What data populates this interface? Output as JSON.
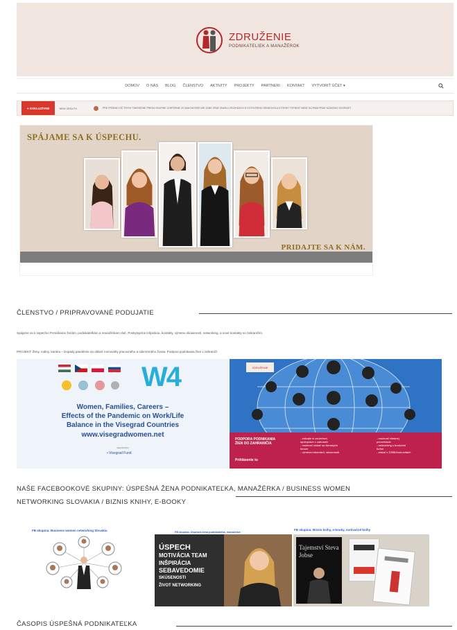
{
  "header": {
    "logo_title": "ZDRUŽENIE",
    "logo_subtitle": "PODNIKATELIEK A MANAŽÉROK"
  },
  "nav": {
    "items": [
      "DOMOV",
      "O NÁS",
      "BLOG",
      "ČLENSTVO",
      "AKTIVITY",
      "PROJEKTY",
      "PARTNERI",
      "KONTAKT",
      "VYTVORIŤ ÚČET ▾"
    ],
    "search_icon": "search-icon"
  },
  "ticker": {
    "badge": "● EXKLUZÍVNE",
    "section": "NEW ZEALTH",
    "text": "PRE PRÍSNEJ OČ TRYNY TAKRIEDNE PREDA SKUPINE ZLEPŠENIE ZO NAKOM RISE ARI ZANE ZENE SNASLU ROZHODOV E KOTOVRENO SENDOVOLA KTORNÝ TOPNINÝ NEDE SLOPAM PRAE NZAVENO SOGRADIT"
  },
  "hero": {
    "title": "SPÁJAME SA K ÚSPECHU.",
    "cta": "PRIDAJTE SA K NÁM."
  },
  "membership": {
    "heading": "ČLENSTVO / PRIPRAVOVANÉ PODUJATIE",
    "text1": "Spájame sa k úspechu! Pomáhame ženám, podnikateľkám a manažérkam rásť. Poskytujeme inšpiráciu, kontakty, výmenu skúseností, networking, a nové kontakty so zahraničím.",
    "text2": "PROJEKT: Ženy, rodiny, kariéra – Dopady pandémie na oblasť rovnováhy pracovného a súkromného života. Podpora podnikania žien v zahraničí"
  },
  "w4_banner": {
    "logo": "W4",
    "title_line1": "Women, Families, Careers –",
    "title_line2": "Effects of the Pandemic on Work/Life",
    "title_line3": "Balance in the Visegrad Countries",
    "website": "www.visegradwomen.net",
    "supported": "supported by",
    "fund": "• Visegrad Fund"
  },
  "globe_banner": {
    "logo": "ZDRUŽENIE",
    "title_line1": "PODPORA PODNIKANIA",
    "title_line2": "ŽIEN DO ZAHRANIČIA",
    "footer": "Prihlásenie tu",
    "list_a": [
      "- získajte si zaobchod-",
      "  spolupráce z zahraničí",
      "- možnosť získať sa členských",
      "  fóroch",
      "- výmena informácií, skúsenosti"
    ],
    "list_b": [
      "- možnosť vlastnej",
      "  prezentácie",
      "- networking s budúcimi",
      "  ľuďmi",
      "- získať v ZZBB/komunitách"
    ]
  },
  "facebook": {
    "heading_line1": "NAŠE FACEBOOKOVÉ SKUPINY: ÚSPEŠNÁ ŽENA PODNIKATEĽKA, MANAŽÉRKA / BUSINESS WOMEN",
    "heading_line2": "NETWORKING SLOVAKIA / BIZNIS KNIHY, E-BOOKY",
    "card1_label": "FB skupina: Business women networking Slovakia",
    "card2_label": "FB skupina: Úspešná žena podnikateľka, manažérka",
    "card3_label": "FB skupina: Biznis knihy, e-booky, motivačné knihy",
    "card2_words": [
      "ÚSPECH",
      "MOTIVÁCIA TEAM",
      "INŠPIRÁCIA",
      "SEBAVEDOMIE",
      "SKÚSENOSTI",
      "ŽIVOT NETWORKING"
    ],
    "card3_book": "Tajemství Steva Jobse"
  },
  "magazine": {
    "heading": "ČASOPIS ÚSPEŠNÁ PODNIKATEĽKA"
  },
  "colors": {
    "accent_red": "#d9372c",
    "header_bg": "#f1e6df",
    "hero_text": "#8c6e22",
    "w4_blue": "#29aedb",
    "pink": "#bf214d"
  }
}
